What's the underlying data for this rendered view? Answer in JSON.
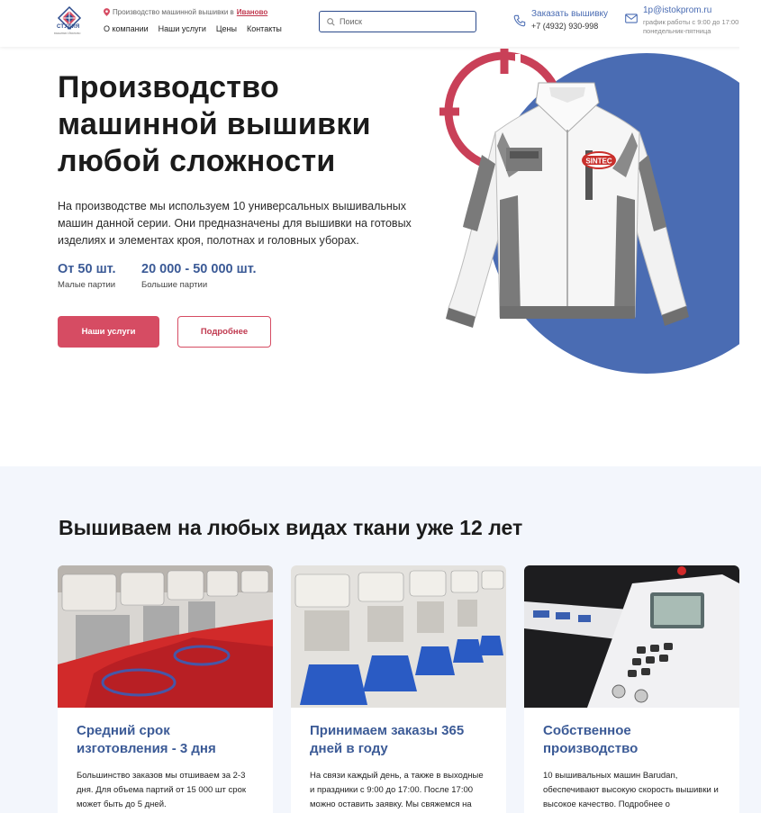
{
  "header": {
    "logo_text": "СТУДИЯ",
    "logo_sub": "вышивки Иваново",
    "location_prefix": "Производство машинной вышивки в",
    "location_city": "Иваново",
    "nav": [
      "О компании",
      "Наши услуги",
      "Цены",
      "Контакты"
    ],
    "search_placeholder": "Поиск",
    "order_label": "Заказать вышивку",
    "phone": "+7 (4932) 930-998",
    "email": "1p@istokprom.ru",
    "hours_line1": "график работы с 9:00 до 17:00",
    "hours_line2": "понедельник-пятница"
  },
  "hero": {
    "title_line1": "Производство",
    "title_line2": "машинной вышивки",
    "title_line3": "любой сложности",
    "description": "На производстве мы используем 10 универсальных вышивальных машин данной серии. Они предназначены для вышивки на готовых изделиях и элементах кроя, полотнах и головных уборах.",
    "stats": [
      {
        "value": "От 50 шт.",
        "label": "Малые партии"
      },
      {
        "value": "20 000 - 50 000 шт.",
        "label": "Большие партии"
      }
    ],
    "primary_button": "Наши услуги",
    "secondary_button": "Подробнее",
    "jacket_logo": "SINTEC"
  },
  "section": {
    "title": "Вышиваем на любых видах ткани уже 12 лет",
    "cards": [
      {
        "title": "Средний срок изготовления - 3 дня",
        "text": "Большинство заказов мы отшиваем за 2-3 дня. Для объема партий от 15 000 шт срок может быть до 5 дней."
      },
      {
        "title": "Принимаем заказы 365 дней в году",
        "text": "На связи каждый день, а также в выходные и праздники с 9:00 до 17:00. После 17:00 можно оставить заявку. Мы свяжемся на следующий день."
      },
      {
        "title": "Собственное производство",
        "text": "10 вышивальных машин Barudan, обеспечивают высокую скорость вышивки и высокое качество. Подробнее о производстве."
      }
    ]
  },
  "colors": {
    "accent_red": "#d64c63",
    "accent_blue": "#3b5a96",
    "circle_blue": "#4a6cb3",
    "section_bg": "#f3f6fc"
  }
}
